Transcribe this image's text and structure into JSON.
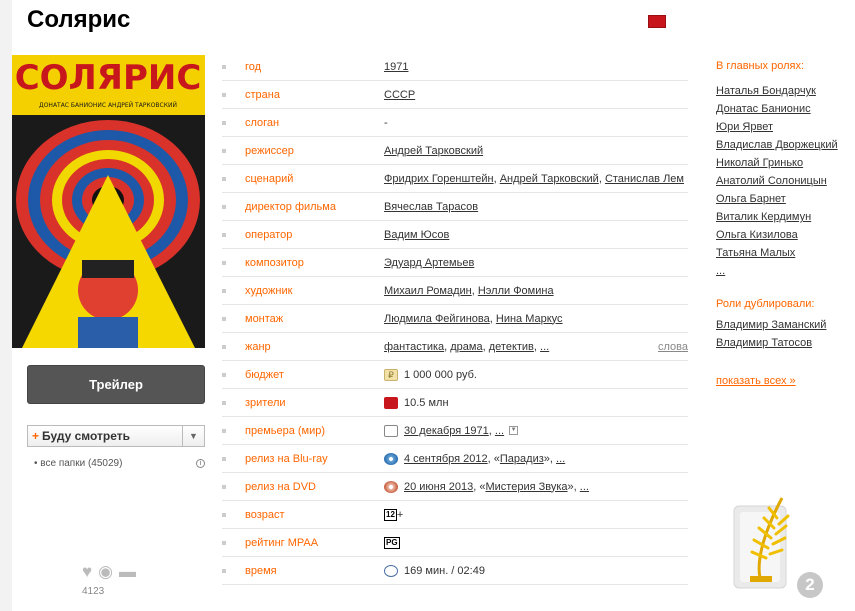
{
  "title": "Солярис",
  "poster": {
    "title_text": "СОЛЯРИС",
    "subtitle_text": "ДОНАТАС БАНИОНИС АНДРЕЙ ТАРКОВСКИЙ"
  },
  "actions": {
    "trailer_label": "Трейлер",
    "folder_label": "Буду смотреть",
    "folders_text": "• все папки (45029)",
    "likes_count": "4123"
  },
  "info": {
    "year": {
      "label": "год",
      "value": "1971"
    },
    "country": {
      "label": "страна",
      "value": "СССР"
    },
    "slogan": {
      "label": "слоган",
      "value": "-"
    },
    "director": {
      "label": "режиссер",
      "value": "Андрей Тарковский"
    },
    "writers": {
      "label": "сценарий",
      "values": [
        "Фридрих Горенштейн",
        "Андрей Тарковский",
        "Станислав Лем"
      ]
    },
    "producer": {
      "label": "директор фильма",
      "value": "Вячеслав Тарасов"
    },
    "operator": {
      "label": "оператор",
      "value": "Вадим Юсов"
    },
    "composer": {
      "label": "композитор",
      "value": "Эдуард Артемьев"
    },
    "artist": {
      "label": "художник",
      "values": [
        "Михаил Ромадин",
        "Нэлли Фомина"
      ]
    },
    "editing": {
      "label": "монтаж",
      "values": [
        "Людмила Фейгинова",
        "Нина Маркус"
      ]
    },
    "genre": {
      "label": "жанр",
      "values": [
        "фантастика",
        "драма",
        "детектив",
        "..."
      ],
      "more": "слова"
    },
    "budget": {
      "label": "бюджет",
      "value": "1 000 000 руб."
    },
    "viewers": {
      "label": "зрители",
      "value": "10.5 млн"
    },
    "premiere": {
      "label": "премьера (мир)",
      "value": "30 декабря 1971",
      "extra": "..."
    },
    "bluray": {
      "label": "релиз на Blu-ray",
      "value": "4 сентября 2012",
      "quote_open": "«",
      "company": "Парадиз",
      "quote_close": "»",
      "extra": "..."
    },
    "dvd": {
      "label": "релиз на DVD",
      "value": "20 июня 2013",
      "quote_open": "«",
      "company": "Мистерия Звука",
      "quote_close": "»",
      "extra": "..."
    },
    "age": {
      "label": "возраст",
      "value": "12",
      "suffix": "+"
    },
    "mpaa": {
      "label": "рейтинг MPAA",
      "value": "PG"
    },
    "time": {
      "label": "время",
      "value": "169 мин. / 02:49"
    }
  },
  "cast": {
    "heading": "В главных ролях:",
    "actors": [
      "Наталья Бондарчук",
      "Донатас Банионис",
      "Юри Ярвет",
      "Владислав Дворжецкий",
      "Николай Гринько",
      "Анатолий Солоницын",
      "Ольга Барнет",
      "Виталик Кердимун",
      "Ольга Кизилова",
      "Татьяна Малых",
      "..."
    ],
    "dub_heading": "Роли дублировали:",
    "dubbers": [
      "Владимир Заманский",
      "Владимир Татосов"
    ],
    "show_all": "показать всех »"
  },
  "award_count": "2",
  "colors": {
    "accent": "#ff6600",
    "button": "#555555"
  }
}
